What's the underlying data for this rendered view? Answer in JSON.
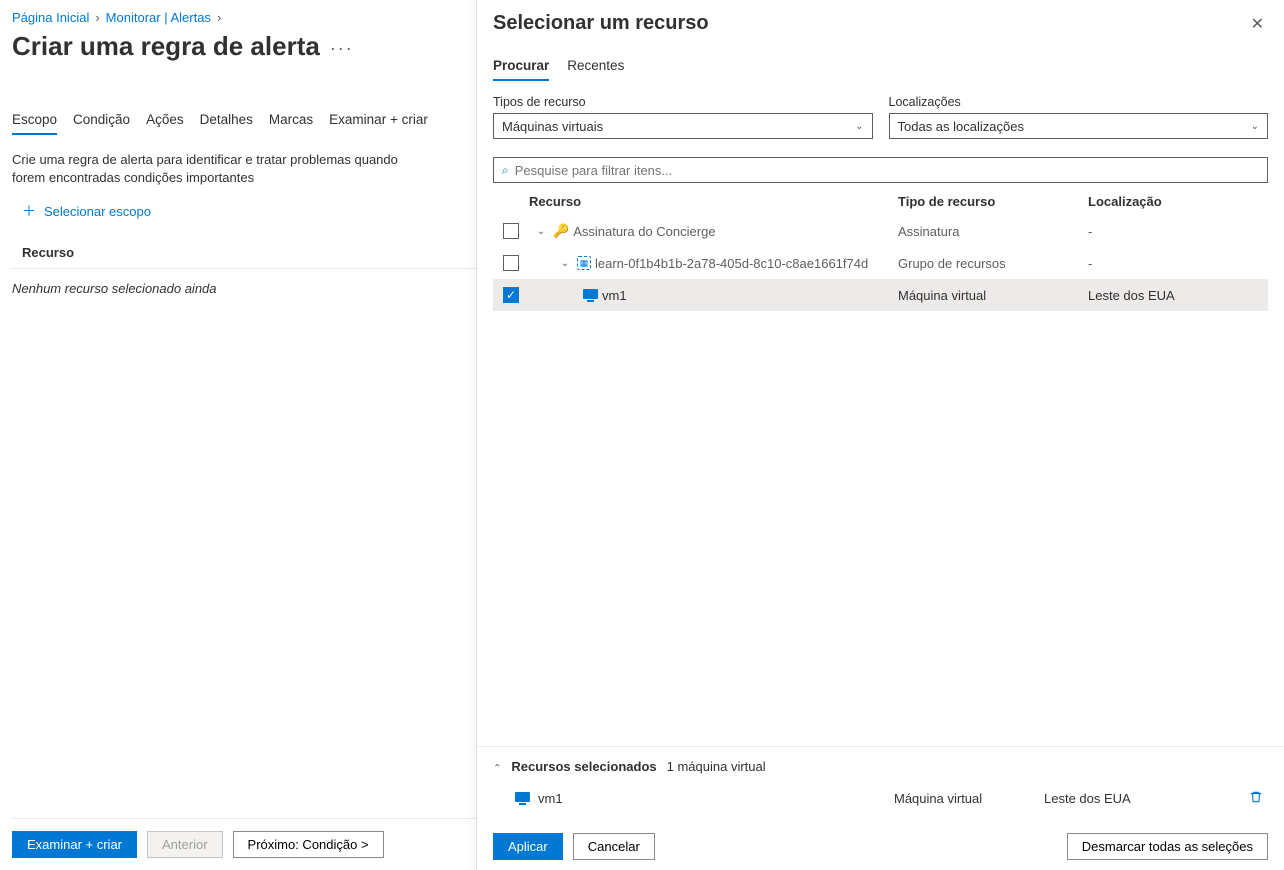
{
  "breadcrumb": {
    "home": "Página Inicial",
    "monitor": "Monitorar | Alertas"
  },
  "page": {
    "title": "Criar uma regra de alerta"
  },
  "tabs": {
    "scope": "Escopo",
    "condition": "Condição",
    "actions": "Ações",
    "details": "Detalhes",
    "tags": "Marcas",
    "review": "Examinar + criar"
  },
  "description": "Crie uma regra de alerta para identificar e tratar problemas quando forem encontradas condições importantes",
  "selectScope": "Selecionar escopo",
  "resourceHeader": "Recurso",
  "noResource": "Nenhum recurso selecionado ainda",
  "footer": {
    "review": "Examinar + criar",
    "prev": "Anterior",
    "next": "Próximo: Condição >"
  },
  "blade": {
    "title": "Selecionar um recurso",
    "tabs": {
      "search": "Procurar",
      "recent": "Recentes"
    },
    "filters": {
      "typeLabel": "Tipos de recurso",
      "typeValue": "Máquinas virtuais",
      "locLabel": "Localizações",
      "locValue": "Todas as localizações"
    },
    "searchPlaceholder": "Pesquise para filtrar itens...",
    "columns": {
      "resource": "Recurso",
      "type": "Tipo de recurso",
      "location": "Localização"
    },
    "rows": {
      "sub": {
        "name": "Assinatura do Concierge",
        "type": "Assinatura",
        "loc": "-"
      },
      "rg": {
        "name": "learn-0f1b4b1b-2a78-405d-8c10-c8ae1661f74d",
        "type": "Grupo de recursos",
        "loc": "-"
      },
      "vm": {
        "name": "vm1",
        "type": "Máquina virtual",
        "loc": "Leste dos EUA"
      }
    },
    "selected": {
      "label": "Recursos selecionados",
      "count": "1 máquina virtual",
      "item": {
        "name": "vm1",
        "type": "Máquina virtual",
        "loc": "Leste dos EUA"
      }
    },
    "footer": {
      "apply": "Aplicar",
      "cancel": "Cancelar",
      "deselect": "Desmarcar todas as seleções"
    }
  }
}
